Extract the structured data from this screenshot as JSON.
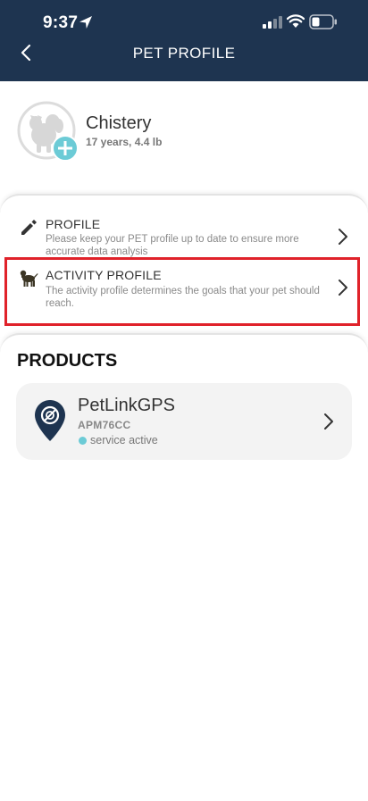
{
  "status_bar": {
    "time": "9:37"
  },
  "nav": {
    "title": "PET PROFILE"
  },
  "pet": {
    "name": "Chistery",
    "info": "17 years, 4.4 lb"
  },
  "menu": [
    {
      "title": "PROFILE",
      "description": "Please keep your PET profile up to date to ensure more accurate data analysis",
      "icon": "pencil-icon"
    },
    {
      "title": "ACTIVITY PROFILE",
      "description": "The activity profile determines the goals that your pet should reach.",
      "icon": "dog-icon"
    }
  ],
  "products": {
    "heading": "PRODUCTS",
    "items": [
      {
        "name": "PetLinkGPS",
        "code": "APM76CC",
        "status": "service active",
        "status_color": "#6ccbd6",
        "icon": "gps-pin-icon"
      }
    ]
  },
  "colors": {
    "header_bg": "#1e3450",
    "accent": "#6ccbd6",
    "highlight": "#e0222a"
  }
}
